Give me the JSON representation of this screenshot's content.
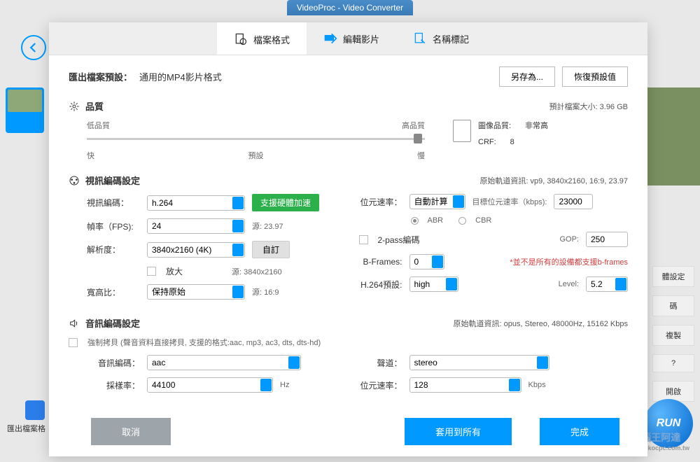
{
  "window_title": "VideoProc - Video Converter",
  "bg": {
    "run": "RUN",
    "brand": "電腦王阿達",
    "brand_url": "www.kocpc.com.tw",
    "right_btns": [
      "體設定",
      "碼",
      "複製",
      "?",
      "開啟"
    ],
    "left_label": "匯出檔案格"
  },
  "tabs": [
    {
      "label": "檔案格式",
      "active": true
    },
    {
      "label": "編輯影片",
      "active": false
    },
    {
      "label": "名稱標記",
      "active": false
    }
  ],
  "preset": {
    "label": "匯出檔案預設：",
    "value": "通用的MP4影片格式",
    "save_as": "另存為...",
    "restore": "恢復預設值"
  },
  "quality": {
    "title": "品質",
    "est_label": "預計檔案大小:",
    "est_value": "3.96 GB",
    "low": "低品質",
    "high": "高品質",
    "fast": "快",
    "preset": "預設",
    "slow": "慢",
    "image_q_label": "圖像品質:",
    "image_q_value": "非常高",
    "crf_label": "CRF:",
    "crf_value": "8"
  },
  "video": {
    "title": "視訊編碼設定",
    "track_info": "原始軌道資訊: vp9, 3840x2160, 16:9, 23.97",
    "codec_label": "視訊編碼：",
    "codec": "h.264",
    "hw_accel": "支援硬體加速",
    "fps_label": "幀率（FPS):",
    "fps": "24",
    "fps_src": "源: 23.97",
    "res_label": "解析度：",
    "res": "3840x2160 (4K)",
    "custom": "自訂",
    "enlarge": "放大",
    "res_src": "源: 3840x2160",
    "aspect_label": "寬高比：",
    "aspect": "保持原始",
    "aspect_src": "源: 16:9",
    "bitrate_label": "位元速率：",
    "bitrate_mode": "自動計算",
    "target_label": "目標位元速率（kbps):",
    "target": "23000",
    "abr": "ABR",
    "cbr": "CBR",
    "twopass": "2-pass編碼",
    "gop_label": "GOP:",
    "gop": "250",
    "bframes_label": "B-Frames:",
    "bframes": "0",
    "bframes_warn": "*並不是所有的設備都支援b-frames",
    "preset_label": "H.264預設:",
    "preset": "high",
    "level_label": "Level:",
    "level": "5.2"
  },
  "audio": {
    "title": "音訊編碼設定",
    "track_info": "原始軌道資訊: opus, Stereo, 48000Hz, 15162 Kbps",
    "force_copy": "強制拷貝 (聲音資料直接拷貝, 支援的格式:aac, mp3, ac3, dts, dts-hd)",
    "codec_label": "音訊編碼：",
    "codec": "aac",
    "sample_label": "採樣率：",
    "sample": "44100",
    "sample_unit": "Hz",
    "channel_label": "聲道：",
    "channel": "stereo",
    "bitrate_label": "位元速率：",
    "bitrate": "128",
    "bitrate_unit": "Kbps"
  },
  "footer": {
    "cancel": "取消",
    "apply_all": "套用到所有",
    "done": "完成"
  }
}
